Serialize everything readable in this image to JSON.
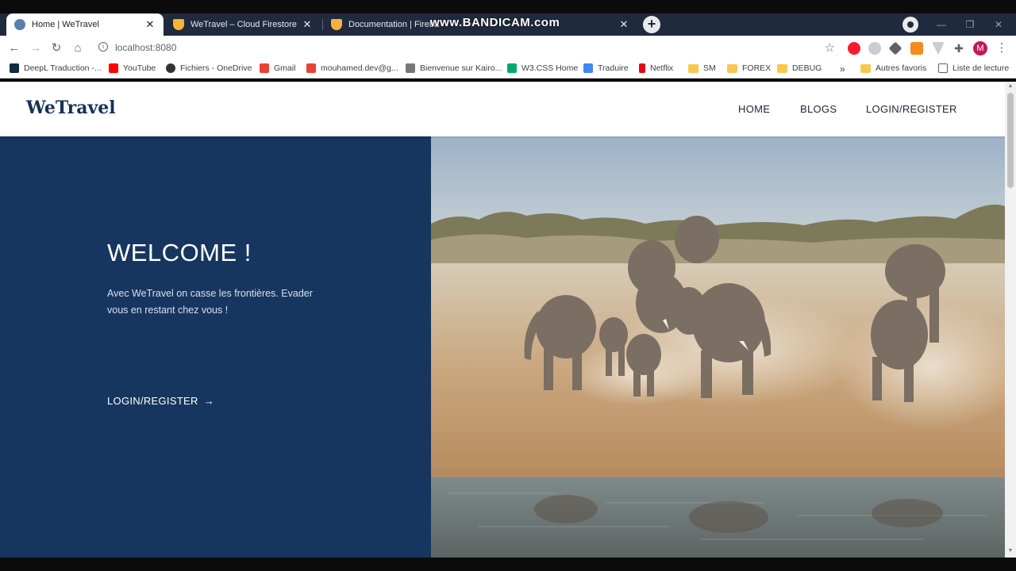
{
  "browser": {
    "tabs": [
      {
        "title": "Home | WeTravel",
        "favicon_color": "#5b7fa8",
        "active": true
      },
      {
        "title": "WeTravel – Cloud Firestore – Fireb",
        "favicon_color": "#f6b23c",
        "active": false
      },
      {
        "title": "Documentation | Fireba",
        "favicon_color": "#f6b23c",
        "active": false
      }
    ],
    "new_tab_label": "+",
    "overlay_watermark": "www.BANDICAM.com",
    "url": "localhost:8080",
    "profile_initial": "M",
    "bookmarks": [
      {
        "label": "DeepL Traduction -...",
        "icon_color": "#0f2b46"
      },
      {
        "label": "YouTube",
        "icon_color": "#ff0000"
      },
      {
        "label": "Fichiers - OneDrive",
        "icon_color": "#333333"
      },
      {
        "label": "Gmail",
        "icon_color": "#ea4335"
      },
      {
        "label": "mouhamed.dev@g...",
        "icon_color": "#ea4335"
      },
      {
        "label": "Bienvenue sur Kairo...",
        "icon_color": "#777777"
      },
      {
        "label": "W3.CSS Home",
        "icon_color": "#04aa6d"
      },
      {
        "label": "Traduire",
        "icon_color": "#4285f4"
      },
      {
        "label": "Netflix",
        "icon_color": "#e50914"
      },
      {
        "label": "SM",
        "folder": true
      },
      {
        "label": "FOREX",
        "folder": true
      },
      {
        "label": "DEBUG",
        "folder": true
      }
    ],
    "more_bookmarks": "»",
    "other_bookmarks": "Autres favoris",
    "reading_list": "Liste de lecture"
  },
  "site": {
    "logo": "WeTravel",
    "nav": [
      "HOME",
      "BLOGS",
      "LOGIN/REGISTER"
    ],
    "hero": {
      "heading": "WELCOME !",
      "tagline": "Avec WeTravel on casse les frontières. Evader vous en restant chez vous !",
      "cta": "LOGIN/REGISTER",
      "cta_arrow": "→"
    }
  },
  "colors": {
    "hero_panel": "#16365f",
    "logo": "#173156",
    "tab_strip": "#202a3e"
  }
}
